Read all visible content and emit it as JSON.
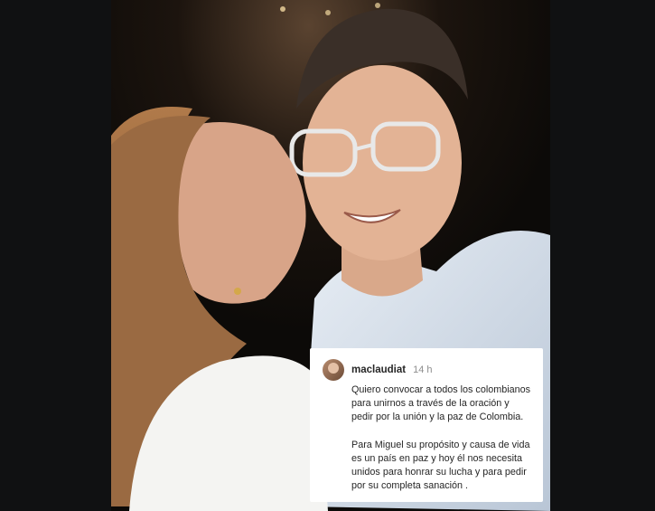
{
  "post": {
    "photo_alt": "",
    "comment": {
      "username": "maclaudiat",
      "time": "14 h",
      "paragraph_1": "Quiero convocar a todos los colombianos para unirnos a través de la oración y pedir por la unión y la paz de Colombia.",
      "paragraph_2": "Para Miguel su propósito y causa de vida es un país en paz y hoy él nos necesita unidos para honrar su lucha y para pedir por su completa sanación ."
    }
  },
  "colors": {
    "background": "#101112",
    "card": "#ffffff",
    "text": "#262626",
    "muted": "#8e8e8e"
  },
  "icons": [
    "user-avatar-icon"
  ]
}
